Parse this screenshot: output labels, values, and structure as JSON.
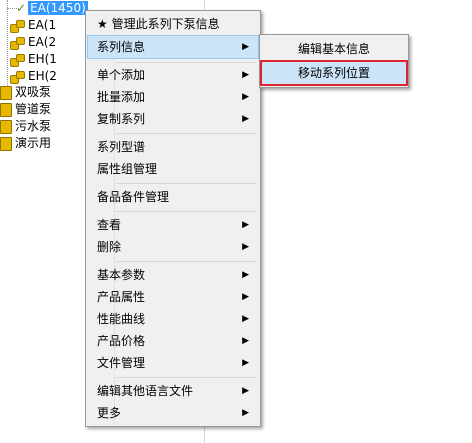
{
  "tree": {
    "nodes": [
      {
        "label": "EA(1450)",
        "selected": true
      },
      {
        "label": "EA(1",
        "selected": false
      },
      {
        "label": "EA(2",
        "selected": false
      },
      {
        "label": "EH(1",
        "selected": false
      },
      {
        "label": "EH(2",
        "selected": false
      }
    ],
    "folders": [
      {
        "label": "双吸泵"
      },
      {
        "label": "管道泵"
      },
      {
        "label": "污水泵"
      },
      {
        "label": "演示用"
      }
    ]
  },
  "menu": {
    "items": [
      {
        "label": "★ 管理此系列下泵信息"
      },
      {
        "label": "系列信息",
        "arrow": "▶"
      },
      {
        "label": "单个添加",
        "arrow": "▶"
      },
      {
        "label": "批量添加",
        "arrow": "▶"
      },
      {
        "label": "复制系列",
        "arrow": "▶"
      },
      {
        "label": "系列型谱"
      },
      {
        "label": "属性组管理"
      },
      {
        "label": "备品备件管理"
      },
      {
        "label": "查看",
        "arrow": "▶"
      },
      {
        "label": "删除",
        "arrow": "▶"
      },
      {
        "label": "基本参数",
        "arrow": "▶"
      },
      {
        "label": "产品属性",
        "arrow": "▶"
      },
      {
        "label": "性能曲线",
        "arrow": "▶"
      },
      {
        "label": "产品价格",
        "arrow": "▶"
      },
      {
        "label": "文件管理",
        "arrow": "▶"
      },
      {
        "label": "编辑其他语言文件",
        "arrow": "▶"
      },
      {
        "label": "更多",
        "arrow": "▶"
      }
    ]
  },
  "submenu": {
    "items": [
      {
        "label": "编辑基本信息"
      },
      {
        "label": "移动系列位置"
      }
    ]
  },
  "colors": {
    "selection": "#3399ff",
    "hover": "#cce4f7",
    "highlight_box": "#e0242f"
  }
}
